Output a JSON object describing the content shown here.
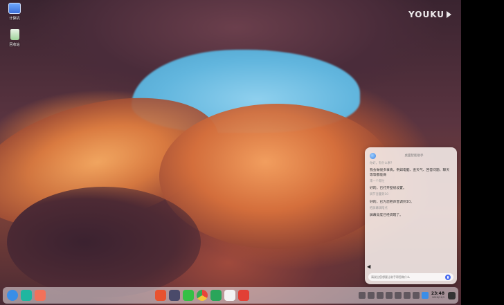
{
  "watermark": {
    "text": "YOUKU"
  },
  "desktop": {
    "icons": [
      {
        "name": "computer",
        "label": "计算机"
      },
      {
        "name": "trash",
        "label": "回收站"
      }
    ]
  },
  "assistant": {
    "title": "桌面智能助手",
    "messages": [
      {
        "role": "user",
        "text": "你好，有什么事？"
      },
      {
        "role": "bot",
        "text": "我会做很多事情，例如电脑、查天气、回答问题、聊天等等都能做"
      },
      {
        "role": "user",
        "text": "来一个帮忙"
      },
      {
        "role": "bot",
        "text": "好的，已打开壁纸设置。"
      },
      {
        "role": "user",
        "text": "调节音量到10"
      },
      {
        "role": "bot",
        "text": "好的，已为您把声音调到10。"
      },
      {
        "role": "user",
        "text": "把屏幕调暗点"
      },
      {
        "role": "bot",
        "text": "屏幕亮度已经调暗了。"
      }
    ],
    "input_placeholder": "请说出您想要让助手帮您做什么"
  },
  "dock": {
    "left_apps": [
      {
        "name": "launcher",
        "color": "#3a8ee8"
      },
      {
        "name": "multitask",
        "color": "#1fb6a0"
      },
      {
        "name": "app-store",
        "color": "#f2715a"
      }
    ],
    "center_apps": [
      {
        "name": "deepin-app",
        "color": "#e8522f"
      },
      {
        "name": "camera",
        "color": "#4a4a6a"
      },
      {
        "name": "wechat",
        "color": "#35c045"
      },
      {
        "name": "chrome",
        "color": "#e8c43a"
      },
      {
        "name": "spreadsheet",
        "color": "#2aa55a"
      },
      {
        "name": "browser",
        "color": "#f3f3f3"
      },
      {
        "name": "presentation",
        "color": "#e24035"
      }
    ],
    "clock": {
      "time": "23:48",
      "date": "2020/11/3"
    }
  }
}
